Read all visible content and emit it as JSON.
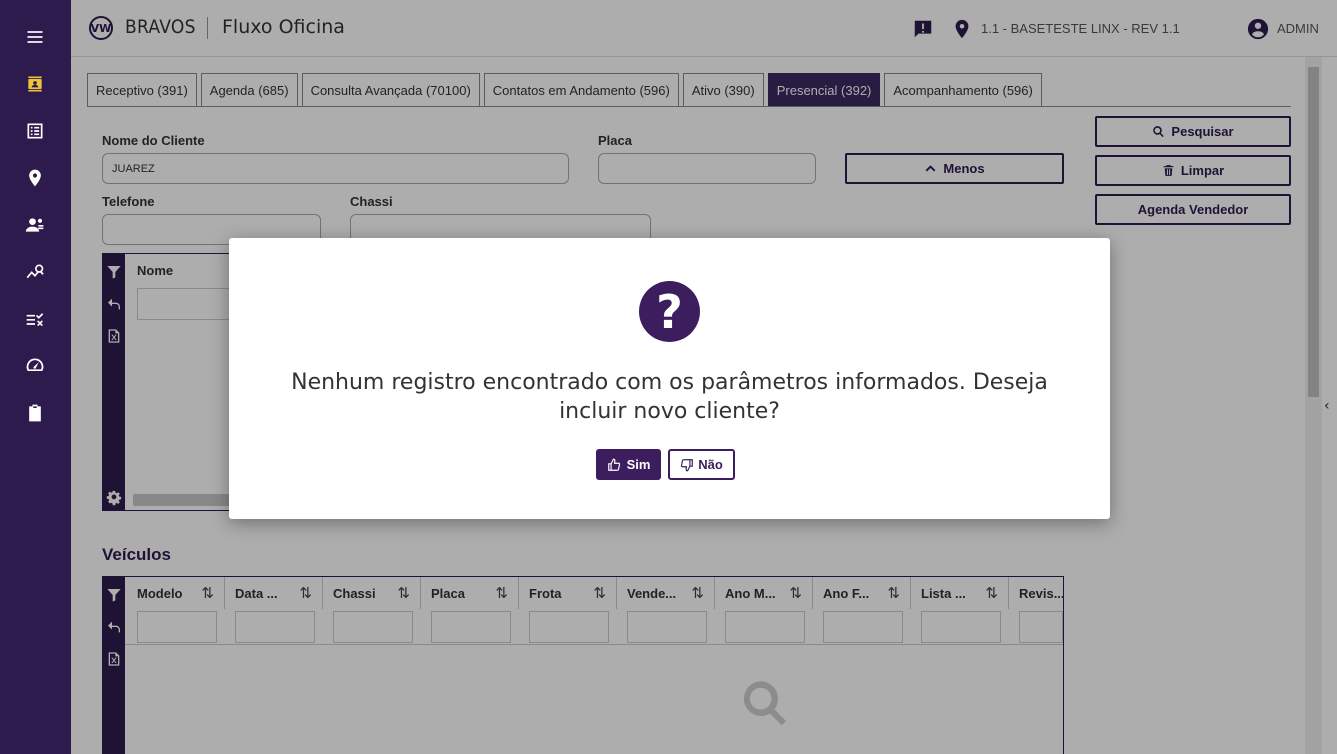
{
  "header": {
    "logo_text": "VW",
    "brand": "BRAVOS",
    "module": "Fluxo Oficina",
    "branch": "1.1 - BASETESTE LINX - REV 1.1",
    "user": "ADMIN"
  },
  "sidebar": {
    "items": [
      "menu-icon",
      "contacts-icon",
      "list-icon",
      "location-icon",
      "people-icon",
      "analytics-icon",
      "checklist-icon",
      "speedometer-icon",
      "clipboard-icon"
    ]
  },
  "tabs": [
    {
      "label": "Receptivo (391)"
    },
    {
      "label": "Agenda (685)"
    },
    {
      "label": "Consulta Avançada (70100)"
    },
    {
      "label": "Contatos em Andamento (596)"
    },
    {
      "label": "Ativo (390)"
    },
    {
      "label": "Presencial (392)",
      "active": true
    },
    {
      "label": "Acompanhamento (596)"
    }
  ],
  "form": {
    "nome_label": "Nome do Cliente",
    "nome_value": "JUAREZ",
    "placa_label": "Placa",
    "placa_value": "",
    "telefone_label": "Telefone",
    "telefone_value": "",
    "chassi_label": "Chassi",
    "chassi_value": "",
    "menos_button": "Menos",
    "pesquisar_button": "Pesquisar",
    "limpar_button": "Limpar",
    "agenda_vendedor_button": "Agenda Vendedor"
  },
  "clientes_grid": {
    "columns": [
      "Nome"
    ]
  },
  "veiculos": {
    "title": "Veículos",
    "columns": [
      "Modelo",
      "Data ...",
      "Chassi",
      "Placa",
      "Frota",
      "Vende...",
      "Ano M...",
      "Ano F...",
      "Lista ...",
      "Revis..."
    ]
  },
  "dialog": {
    "icon": "question-icon",
    "message": "Nenhum registro encontrado com os parâmetros informados. Deseja incluir novo cliente?",
    "yes_label": "Sim",
    "no_label": "Não"
  },
  "colors": {
    "brand": "#2d1b4e",
    "accent": "#3c1e5e",
    "active_icon": "#f0c33c"
  }
}
